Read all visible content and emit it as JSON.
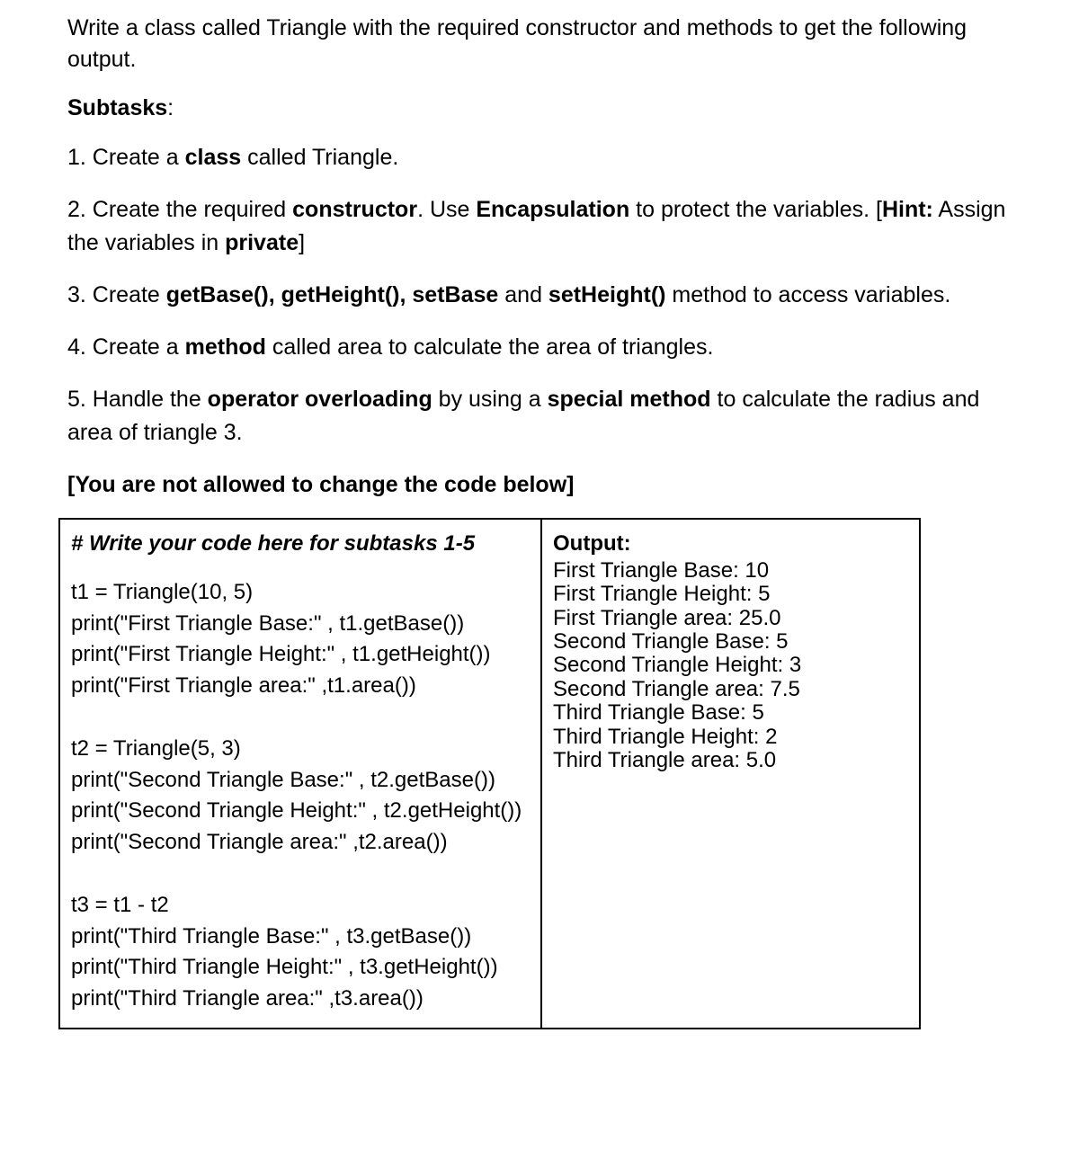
{
  "intro": "Write a class called Triangle with the required constructor and methods to get the following output.",
  "subtasks_label": "Subtasks",
  "subtasks_colon": ":",
  "tasks": {
    "t1": {
      "prefix": "1. Create a ",
      "b1": "class",
      "suffix": " called Triangle."
    },
    "t2": {
      "prefix": "2. Create the required ",
      "b1": "constructor",
      "mid1": ". Use ",
      "b2": "Encapsulation",
      "mid2": " to protect the variables. [",
      "b3": "Hint:",
      "mid3": " Assign the variables in ",
      "b4": "private",
      "suffix": "]"
    },
    "t3": {
      "prefix": "3. Create ",
      "b1": "getBase(), getHeight(), setBase",
      "mid1": " and ",
      "b2": "setHeight()",
      "suffix": " method to access variables."
    },
    "t4": {
      "prefix": "4. Create a ",
      "b1": "method",
      "suffix": " called area to calculate the area of triangles."
    },
    "t5": {
      "prefix": "5. Handle the ",
      "b1": "operator overloading",
      "mid1": " by using a ",
      "b2": "special method",
      "suffix": " to calculate the radius and area of triangle 3."
    }
  },
  "locked_note": "[You are not allowed to change the code below]",
  "code_header": "# Write your code here for subtasks 1-5",
  "code_body": "t1 = Triangle(10, 5)\nprint(\"First Triangle Base:\" , t1.getBase())\nprint(\"First Triangle Height:\" , t1.getHeight())\nprint(\"First Triangle area:\" ,t1.area())\n\nt2 = Triangle(5, 3)\nprint(\"Second Triangle Base:\" , t2.getBase())\nprint(\"Second Triangle Height:\" , t2.getHeight())\nprint(\"Second Triangle area:\" ,t2.area())\n\nt3 = t1 - t2\nprint(\"Third Triangle Base:\" , t3.getBase())\nprint(\"Third Triangle Height:\" , t3.getHeight())\nprint(\"Third Triangle area:\" ,t3.area())",
  "output_header": "Output:",
  "output_body": "First Triangle Base: 10\nFirst Triangle Height: 5\nFirst Triangle area: 25.0\nSecond Triangle Base: 5\nSecond Triangle Height: 3\nSecond Triangle area: 7.5\nThird Triangle Base: 5\nThird Triangle Height: 2\nThird Triangle area: 5.0"
}
